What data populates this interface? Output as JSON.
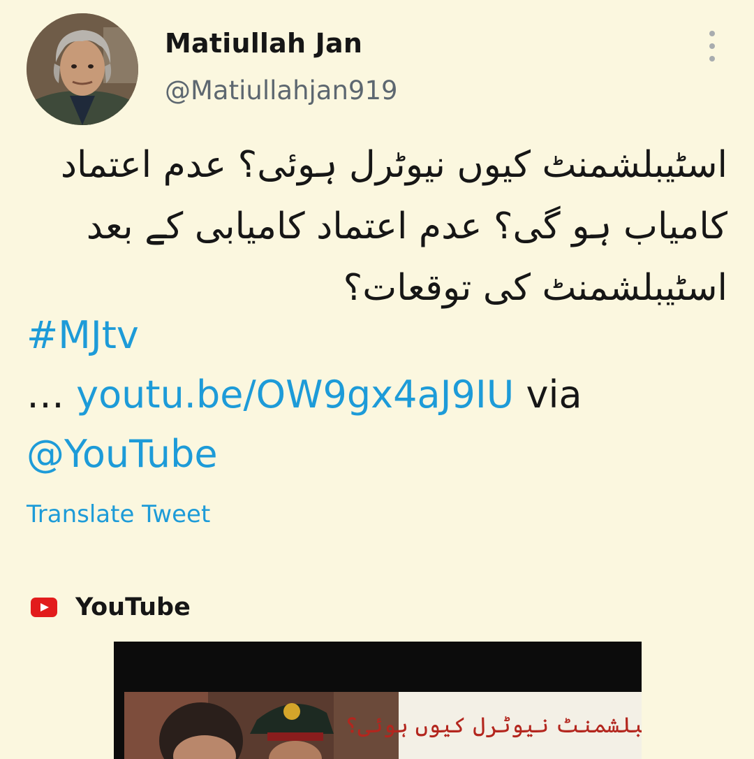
{
  "tweet": {
    "author": {
      "display_name": "Matiullah Jan",
      "handle": "@Matiullahjan919",
      "avatar_icon": "profile-photo"
    },
    "more_icon": "vertical-ellipsis-icon",
    "body_urdu": "اسٹیبلشمنٹ کیوں نیوٹرل ہوئی؟ عدم اعتماد کامیاب ہو گی؟ عدم اعتماد کامیابی کے بعد اسٹیبلشمنٹ کی توقعات؟",
    "hashtag": "#MJtv",
    "link_prefix": "… ",
    "link_url": "youtu.be/OW9gx4aJ9IU",
    "link_via": " via",
    "mention": "@YouTube",
    "translate_label": "Translate Tweet"
  },
  "card": {
    "source_icon": "youtube-logo-icon",
    "source_name": "YouTube",
    "thumbnail_caption": "اسٹیبلشمنٹ نیوٹرل کیوں ہوئی؟"
  },
  "colors": {
    "background": "#fbf7df",
    "link": "#1d9bd8",
    "youtube_red": "#e21c1c",
    "handle_gray": "#5d6770"
  }
}
